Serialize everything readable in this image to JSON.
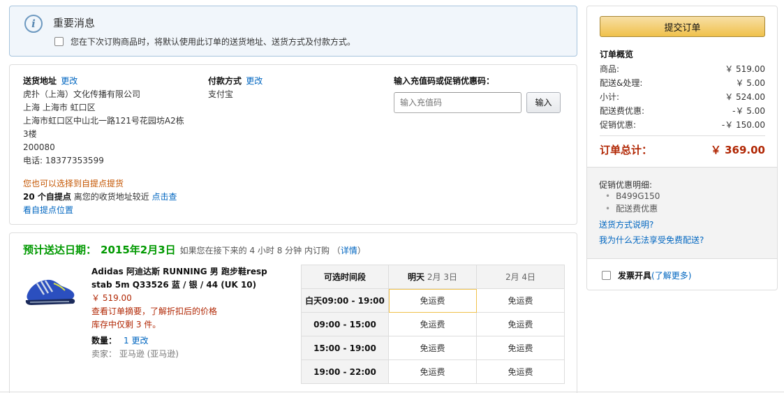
{
  "notice": {
    "title": "重要消息",
    "checkbox_label": "您在下次订购商品时，将默认使用此订单的送货地址、送货方式及付款方式。"
  },
  "shipping": {
    "header": "送货地址",
    "change": "更改",
    "lines": [
      "虎扑（上海）文化传播有限公司",
      "上海 上海市 虹口区",
      "上海市虹口区中山北一路121号花园坊A2栋",
      "3楼",
      "200080",
      "电话: 18377353599"
    ],
    "pickup_hint": "您也可以选择到自提点提货",
    "pickup_count": "20 个自提点",
    "pickup_near": " 离您的收货地址较近 ",
    "pickup_link_1": "点击查",
    "pickup_link_2": "看自提点位置"
  },
  "payment": {
    "header": "付款方式",
    "change": "更改",
    "method": "支付宝"
  },
  "code": {
    "header": "输入充值码或促销优惠码：",
    "placeholder": "输入充值码",
    "button": "输入"
  },
  "delivery": {
    "label": "预计送达日期：",
    "date": "2015年2月3日",
    "note": "如果您在接下来的 4 小时 8 分钟 内订购 （",
    "details": "详情",
    "note_end": "）"
  },
  "product": {
    "name": "Adidas 阿迪达斯 RUNNING 男 跑步鞋resp stab 5m Q33526 蓝 / 银 / 44 (UK 10)",
    "price": "￥ 519.00",
    "summary": "查看订单摘要，了解折扣后的价格",
    "stock": "库存中仅剩 3 件。",
    "qty_label": "数量：",
    "qty": "1",
    "qty_change": "更改",
    "seller": "卖家： 亚马逊 (亚马逊)"
  },
  "slots": {
    "header": "可选时间段",
    "days": [
      {
        "bold": "明天",
        "date": "2月 3日"
      },
      {
        "bold": "",
        "date": "2月 4日"
      }
    ],
    "rows": [
      {
        "time": "白天09:00 - 19:00",
        "d1": "免运费",
        "d2": "免运费"
      },
      {
        "time": "09:00 - 15:00",
        "d1": "免运费",
        "d2": "免运费"
      },
      {
        "time": "15:00 - 19:00",
        "d1": "免运费",
        "d2": "免运费"
      },
      {
        "time": "19:00 - 22:00",
        "d1": "免运费",
        "d2": "免运费"
      }
    ]
  },
  "summary": {
    "submit": "提交订单",
    "title": "订单概览",
    "rows": [
      {
        "label": "商品:",
        "value": "￥ 519.00"
      },
      {
        "label": "配送&处理:",
        "value": "￥ 5.00"
      },
      {
        "label": "小计:",
        "value": "￥ 524.00"
      },
      {
        "label": "配送费优惠:",
        "value": "-￥ 5.00"
      },
      {
        "label": "促销优惠:",
        "value": "-￥ 150.00"
      }
    ],
    "total_label": "订单总计：",
    "total_value": "￥ 369.00",
    "promo_title": "促销优惠明细:",
    "promo_items": [
      "B499G150",
      "配送费优惠"
    ],
    "link_shipping": "送货方式说明?",
    "link_free": "我为什么无法享受免费配送?",
    "invoice_label": "发票开具",
    "invoice_link_open": "(",
    "invoice_link": "了解更多",
    "invoice_link_close": ")"
  },
  "colors": {
    "accent_green": "#009900",
    "price_red": "#b12704",
    "link_blue": "#0066c0",
    "button_gold": "#f0c14b"
  }
}
